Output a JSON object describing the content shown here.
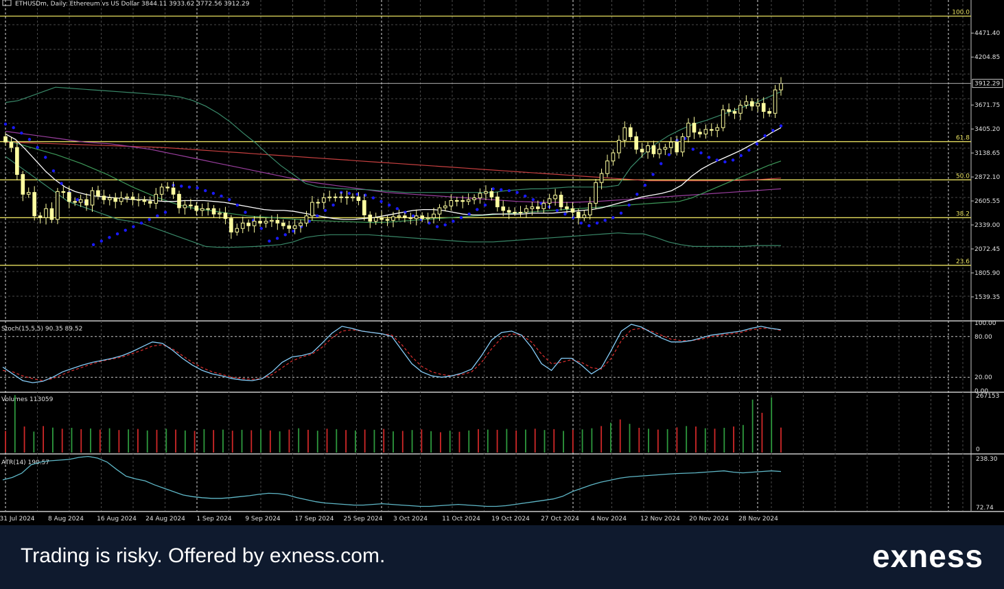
{
  "header": {
    "title": "ETHUSDm, Daily: Ethereum vs US Dollar  3844.11 3933.62 3772.56 3912.29"
  },
  "footer": {
    "disclaimer": "Trading is risky. Offered by exness.com.",
    "brand": "exness"
  },
  "colors": {
    "background": "#000000",
    "grid": "#4a4a4a",
    "bull_candle": "#ffffa0",
    "bear_candle": "#ffffa0",
    "fib": "#e8e060",
    "parabolic_sar": "#1a1aff",
    "ma_white": "#ffffff",
    "ma_green": "#3e9a5a",
    "ma_purple": "#9b3fa0",
    "ma_red": "#c84040",
    "bollinger": "#3a8a6a",
    "stoch_main": "#87cefa",
    "stoch_signal": "#e03030",
    "vol_up": "#2e9a3e",
    "vol_down": "#d02828",
    "atr": "#5fb8c8",
    "footer_bg": "#0f1a2e"
  },
  "chart_data": [
    {
      "type": "candlestick",
      "title": "ETHUSDm, Daily: Ethereum vs US Dollar  3844.11 3933.62 3772.56 3912.29",
      "ylim": [
        1280,
        4740
      ],
      "y_ticks": [
        "4471.40",
        "4204.85",
        "3671.75",
        "3405.20",
        "3138.65",
        "2872.10",
        "2605.55",
        "2339.00",
        "2072.45",
        "1805.90",
        "1539.35"
      ],
      "current_price": "3912.29",
      "x_labels": [
        "31 Jul 2024",
        "8 Aug 2024",
        "16 Aug 2024",
        "24 Aug 2024",
        "1 Sep 2024",
        "9 Sep 2024",
        "17 Sep 2024",
        "25 Sep 2024",
        "3 Oct 2024",
        "11 Oct 2024",
        "19 Oct 2024",
        "27 Oct 2024",
        "4 Nov 2024",
        "12 Nov 2024",
        "20 Nov 2024",
        "28 Nov 2024"
      ],
      "fib_levels": [
        {
          "label": "100.0",
          "value": 4660
        },
        {
          "label": "61.8",
          "value": 3265
        },
        {
          "label": "50.0",
          "value": 2840
        },
        {
          "label": "38.2",
          "value": 2420
        },
        {
          "label": "23.6",
          "value": 1890
        }
      ],
      "close": [
        3260,
        3200,
        2900,
        2680,
        2700,
        2440,
        2420,
        2520,
        2400,
        2710,
        2700,
        2600,
        2590,
        2620,
        2560,
        2720,
        2660,
        2620,
        2640,
        2600,
        2640,
        2650,
        2620,
        2620,
        2600,
        2580,
        2680,
        2760,
        2750,
        2680,
        2530,
        2560,
        2550,
        2500,
        2520,
        2520,
        2460,
        2470,
        2410,
        2260,
        2300,
        2360,
        2330,
        2380,
        2360,
        2380,
        2390,
        2360,
        2330,
        2300,
        2330,
        2360,
        2440,
        2590,
        2590,
        2640,
        2650,
        2650,
        2650,
        2640,
        2650,
        2610,
        2450,
        2380,
        2420,
        2400,
        2390,
        2430,
        2440,
        2420,
        2410,
        2440,
        2410,
        2420,
        2460,
        2530,
        2550,
        2610,
        2610,
        2600,
        2620,
        2640,
        2690,
        2710,
        2650,
        2540,
        2500,
        2480,
        2480,
        2480,
        2520,
        2540,
        2520,
        2580,
        2630,
        2670,
        2540,
        2520,
        2480,
        2420,
        2450,
        2580,
        2810,
        2910,
        3050,
        3140,
        3280,
        3420,
        3320,
        3180,
        3150,
        3220,
        3130,
        3180,
        3200,
        3260,
        3150,
        3320,
        3470,
        3370,
        3350,
        3400,
        3390,
        3420,
        3620,
        3600,
        3580,
        3670,
        3710,
        3660,
        3690,
        3600,
        3580,
        3840,
        3912
      ],
      "ma_white": [
        3350,
        3290,
        3180,
        3060,
        2940,
        2840,
        2760,
        2710,
        2680,
        2660,
        2650,
        2640,
        2630,
        2620,
        2620,
        2610,
        2600,
        2600,
        2610,
        2610,
        2610,
        2600,
        2590,
        2570,
        2550,
        2530,
        2510,
        2500,
        2500,
        2490,
        2470,
        2450,
        2430,
        2410,
        2400,
        2400,
        2410,
        2420,
        2440,
        2460,
        2480,
        2500,
        2510,
        2510,
        2500,
        2480,
        2460,
        2450,
        2450,
        2460,
        2460,
        2460,
        2460,
        2470,
        2470,
        2470,
        2480,
        2490,
        2500,
        2510,
        2530,
        2560,
        2590,
        2620,
        2650,
        2670,
        2690,
        2720,
        2780,
        2880,
        2960,
        3020,
        3070,
        3120,
        3170,
        3230,
        3290,
        3360,
        3420
      ],
      "parabolic_sar": [
        3460,
        3420,
        3360,
        3290,
        3200,
        3090,
        2940,
        2800,
        2700,
        2620,
        2590,
        2120,
        2160,
        2200,
        2240,
        2280,
        2320,
        2360,
        2400,
        2440,
        2480,
        2780,
        2770,
        2760,
        2750,
        2720,
        2690,
        2660,
        2620,
        2560,
        2480,
        2390,
        2300,
        2160,
        2190,
        2230,
        2270,
        2320,
        2380,
        2440,
        2500,
        2560,
        2700,
        2690,
        2680,
        2670,
        2640,
        2600,
        2560,
        2520,
        2480,
        2440,
        2400,
        2360,
        2320,
        2340,
        2380,
        2420,
        2460,
        2510,
        2560,
        2740,
        2730,
        2720,
        2700,
        2660,
        2620,
        2580,
        2540,
        2500,
        2460,
        2420,
        2360,
        2330,
        2360,
        2390,
        2420,
        2470,
        2560,
        2680,
        2780,
        2900,
        3020,
        3120,
        3280,
        3300,
        3180,
        3140,
        3090,
        3060,
        3040,
        3060,
        3110,
        3170,
        3240,
        3330,
        3390,
        3440
      ],
      "ma_green": [
        3280,
        3240,
        3200,
        3160,
        3120,
        3070,
        3020,
        2960,
        2900,
        2830,
        2760,
        2700,
        2640,
        2590,
        2550,
        2520,
        2500,
        2480,
        2460,
        2440,
        2430,
        2420,
        2410,
        2400,
        2390,
        2385,
        2380,
        2375,
        2370,
        2365,
        2370,
        2380,
        2390,
        2400,
        2410,
        2420,
        2430,
        2440,
        2450,
        2460,
        2470,
        2480,
        2490,
        2500,
        2510,
        2520,
        2530,
        2540,
        2550,
        2560,
        2570,
        2580,
        2590,
        2600,
        2640,
        2700,
        2760,
        2820,
        2880,
        2940,
        3000,
        3050
      ],
      "ma_purple": [
        3380,
        3360,
        3340,
        3320,
        3300,
        3280,
        3260,
        3250,
        3240,
        3220,
        3200,
        3180,
        3150,
        3120,
        3090,
        3060,
        3030,
        3000,
        2970,
        2940,
        2910,
        2880,
        2850,
        2820,
        2800,
        2780,
        2760,
        2740,
        2720,
        2700,
        2690,
        2680,
        2670,
        2660,
        2650,
        2640,
        2630,
        2620,
        2610,
        2600,
        2595,
        2590,
        2590,
        2590,
        2595,
        2600,
        2610,
        2620,
        2630,
        2640,
        2650,
        2660,
        2670,
        2680,
        2690,
        2700,
        2710,
        2720,
        2730,
        2740
      ],
      "ma_red": [
        3260,
        3255,
        3250,
        3245,
        3240,
        3235,
        3230,
        3225,
        3220,
        3215,
        3210,
        3205,
        3200,
        3190,
        3180,
        3170,
        3160,
        3150,
        3140,
        3130,
        3120,
        3110,
        3100,
        3090,
        3080,
        3070,
        3060,
        3050,
        3040,
        3030,
        3020,
        3010,
        3000,
        2990,
        2980,
        2970,
        2960,
        2950,
        2940,
        2930,
        2920,
        2910,
        2900,
        2890,
        2880,
        2870,
        2860,
        2850,
        2840,
        2830,
        2830,
        2830,
        2830,
        2830,
        2830,
        2830,
        2835,
        2840,
        2850,
        2860
      ],
      "bollinger_upper": [
        3700,
        3720,
        3770,
        3820,
        3870,
        3860,
        3850,
        3840,
        3830,
        3820,
        3810,
        3800,
        3790,
        3780,
        3760,
        3720,
        3660,
        3580,
        3480,
        3360,
        3250,
        3120,
        3000,
        2900,
        2800,
        2760,
        2750,
        2740,
        2735,
        2730,
        2720,
        2710,
        2700,
        2700,
        2700,
        2700,
        2700,
        2700,
        2700,
        2700,
        2720,
        2730,
        2740,
        2740,
        2750,
        2760,
        2760,
        2760,
        2760,
        2780,
        2980,
        3120,
        3240,
        3330,
        3400,
        3460,
        3500,
        3550,
        3600,
        3650,
        3700,
        3760,
        3820
      ],
      "bollinger_lower": [
        3100,
        3000,
        2900,
        2800,
        2700,
        2600,
        2550,
        2500,
        2450,
        2400,
        2380,
        2350,
        2300,
        2250,
        2200,
        2150,
        2100,
        2090,
        2090,
        2095,
        2100,
        2110,
        2120,
        2150,
        2200,
        2220,
        2230,
        2230,
        2230,
        2230,
        2220,
        2210,
        2200,
        2190,
        2180,
        2170,
        2160,
        2150,
        2150,
        2150,
        2160,
        2170,
        2180,
        2190,
        2200,
        2210,
        2220,
        2230,
        2240,
        2250,
        2240,
        2240,
        2200,
        2150,
        2120,
        2100,
        2100,
        2100,
        2100,
        2100,
        2110,
        2110,
        2110
      ]
    },
    {
      "type": "line",
      "title": "Stoch(15,5,5) 90.35 89.52",
      "ylim": [
        0,
        100
      ],
      "y_ticks": [
        "100.00",
        "80.00",
        "20.00",
        "0.00"
      ],
      "series": [
        {
          "name": "main",
          "values": [
            35,
            25,
            15,
            12,
            14,
            20,
            28,
            33,
            38,
            42,
            45,
            48,
            52,
            58,
            65,
            72,
            70,
            60,
            48,
            38,
            30,
            25,
            22,
            18,
            16,
            15,
            18,
            28,
            42,
            50,
            52,
            56,
            70,
            85,
            95,
            92,
            88,
            86,
            84,
            80,
            60,
            40,
            28,
            22,
            20,
            22,
            26,
            32,
            52,
            75,
            86,
            88,
            82,
            64,
            40,
            30,
            48,
            48,
            38,
            25,
            34,
            60,
            88,
            98,
            94,
            86,
            78,
            72,
            72,
            74,
            78,
            82,
            84,
            86,
            88,
            92,
            95,
            92,
            90
          ]
        },
        {
          "name": "signal",
          "values": [
            30,
            28,
            22,
            18,
            15,
            18,
            24,
            30,
            35,
            40,
            44,
            47,
            50,
            55,
            60,
            66,
            68,
            62,
            52,
            42,
            34,
            28,
            24,
            20,
            18,
            17,
            18,
            24,
            34,
            44,
            50,
            54,
            64,
            78,
            88,
            90,
            88,
            86,
            84,
            82,
            68,
            50,
            36,
            28,
            24,
            22,
            24,
            28,
            42,
            62,
            78,
            84,
            82,
            72,
            54,
            40,
            42,
            46,
            42,
            34,
            32,
            48,
            74,
            90,
            92,
            88,
            82,
            76,
            74,
            74,
            76,
            80,
            82,
            84,
            86,
            90,
            92,
            92,
            89
          ]
        }
      ]
    },
    {
      "type": "bar",
      "title": "Volumes 113059",
      "ylim": [
        0,
        267153
      ],
      "y_ticks": [
        "267153",
        "0"
      ],
      "values": [
        98000,
        260000,
        118000,
        95000,
        120000,
        113000,
        108000,
        112000,
        106000,
        109000,
        104000,
        110000,
        102000,
        105000,
        107000,
        100000,
        103000,
        108000,
        104000,
        100000,
        98000,
        106000,
        102000,
        104000,
        99000,
        103000,
        101000,
        105000,
        100000,
        96000,
        104000,
        110000,
        103000,
        99000,
        108000,
        106000,
        102000,
        100000,
        104000,
        103000,
        107000,
        96000,
        98000,
        102000,
        105000,
        97000,
        92000,
        99000,
        94000,
        100000,
        106000,
        104000,
        103000,
        107000,
        100000,
        104000,
        108000,
        102000,
        106000,
        98000,
        103000,
        105000,
        110000,
        120000,
        135000,
        150000,
        130000,
        112000,
        108000,
        104000,
        106000,
        114000,
        120000,
        118000,
        110000,
        108000,
        112000,
        118000,
        125000,
        240000,
        180000,
        250000,
        113059
      ],
      "directions": [
        "d",
        "u",
        "d",
        "u",
        "d",
        "u",
        "d",
        "u",
        "d",
        "u",
        "d",
        "u",
        "d",
        "u",
        "d",
        "u",
        "d",
        "u",
        "d",
        "u",
        "d",
        "u",
        "d",
        "u",
        "d",
        "u",
        "d",
        "u",
        "d",
        "u",
        "d",
        "u",
        "d",
        "u",
        "d",
        "u",
        "d",
        "u",
        "d",
        "u",
        "d",
        "u",
        "d",
        "u",
        "d",
        "u",
        "d",
        "u",
        "d",
        "u",
        "d",
        "u",
        "d",
        "u",
        "d",
        "u",
        "d",
        "u",
        "d",
        "u",
        "d",
        "u",
        "u",
        "d",
        "u",
        "d",
        "u",
        "d",
        "u",
        "d",
        "u",
        "d",
        "u",
        "d",
        "u",
        "d",
        "u",
        "d",
        "u",
        "u",
        "d",
        "u",
        "d"
      ]
    },
    {
      "type": "line",
      "title": "ATR(14) 190.57",
      "ylim": [
        72.74,
        238.3
      ],
      "y_ticks": [
        "238.30",
        "72.74"
      ],
      "values": [
        165,
        172,
        185,
        210,
        218,
        222,
        224,
        226,
        232,
        235,
        230,
        218,
        196,
        176,
        168,
        162,
        150,
        140,
        130,
        120,
        115,
        112,
        110,
        110,
        112,
        115,
        118,
        122,
        125,
        124,
        120,
        112,
        106,
        100,
        96,
        94,
        92,
        90,
        90,
        92,
        94,
        92,
        90,
        88,
        86,
        86,
        88,
        90,
        92,
        90,
        88,
        86,
        86,
        88,
        92,
        96,
        100,
        104,
        108,
        116,
        130,
        140,
        150,
        158,
        164,
        170,
        174,
        176,
        178,
        180,
        182,
        184,
        185,
        186,
        188,
        190,
        192,
        188,
        186,
        188,
        190,
        192,
        190
      ]
    }
  ]
}
